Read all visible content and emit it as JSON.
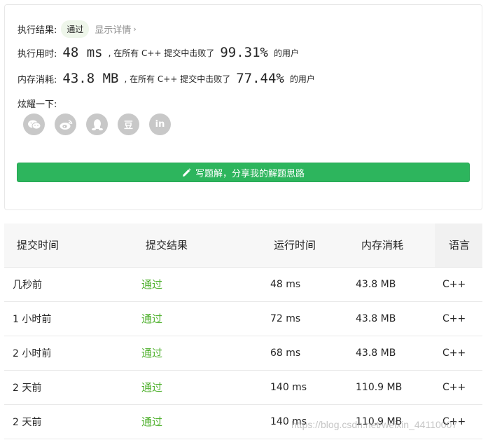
{
  "result": {
    "label": "执行结果:",
    "status": "通过",
    "detail_link": "显示详情",
    "chevron": "›"
  },
  "runtime": {
    "label": "执行用时:",
    "value": "48 ms",
    "middle": ", 在所有 C++ 提交中击败了",
    "percent": "99.31%",
    "suffix": "的用户"
  },
  "memory": {
    "label": "内存消耗:",
    "value": "43.8 MB",
    "middle": ", 在所有 C++ 提交中击败了",
    "percent": "77.44%",
    "suffix": "的用户"
  },
  "share": {
    "label": "炫耀一下:",
    "icons": [
      "wechat-icon",
      "weibo-icon",
      "qq-icon",
      "douban-icon",
      "linkedin-icon"
    ],
    "douban_glyph": "豆",
    "linkedin_glyph": "in"
  },
  "write_solution": {
    "label": "写题解，分享我的解题思路"
  },
  "table": {
    "headers": [
      "提交时间",
      "提交结果",
      "运行时间",
      "内存消耗",
      "语言"
    ],
    "rows": [
      [
        "几秒前",
        "通过",
        "48 ms",
        "43.8 MB",
        "C++"
      ],
      [
        "1 小时前",
        "通过",
        "72 ms",
        "43.8 MB",
        "C++"
      ],
      [
        "2 小时前",
        "通过",
        "68 ms",
        "43.8 MB",
        "C++"
      ],
      [
        "2 天前",
        "通过",
        "140 ms",
        "110.9 MB",
        "C++"
      ],
      [
        "2 天前",
        "通过",
        "140 ms",
        "110.9 MB",
        "C++"
      ]
    ]
  },
  "watermark": "https://blog.csdn.net/weixin_44110007",
  "colors": {
    "accent": "#2db55d",
    "pass": "#4caf2a",
    "icon_gray": "#c8c8c8"
  }
}
